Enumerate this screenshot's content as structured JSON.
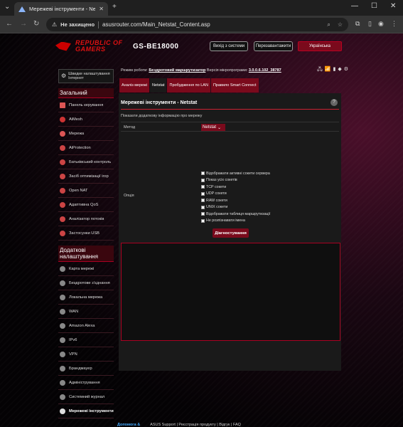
{
  "browser": {
    "tab_title": "Мережеві інструменти - Netst",
    "url_scheme": "Не захищено",
    "url": "asusrouter.com/Main_Netstat_Content.asp"
  },
  "header": {
    "brand_line1": "REPUBLIC OF",
    "brand_line2": "GAMERS",
    "model": "GS-BE18000",
    "logout": "Вихід з системи",
    "reboot": "Перезавантажити",
    "language": "Українська"
  },
  "sidebar": {
    "quick_setup": "Швидке налаштування Інтернет",
    "general_title": "Загальний",
    "general_items": [
      "Панель керування",
      "AiMesh",
      "Мережа",
      "AiProtection",
      "Батьківський контроль",
      "Засіб оптимізації ігор",
      "Open NAT",
      "Адаптивна QoS",
      "Аналізатор потоків",
      "Застосунки USB"
    ],
    "advanced_title": "Додаткові налаштування",
    "advanced_items": [
      "Карта мережі",
      "Бездротове з'єднання",
      "Локальна мережа",
      "WAN",
      "Amazon Alexa",
      "IPv6",
      "VPN",
      "Брандмауер",
      "Адміністрування",
      "Системний журнал",
      "Мережеві інструменти"
    ]
  },
  "status": {
    "mode_label": "Режим роботи:",
    "mode_value": "Бездротовий маршрутизатор",
    "fw_label": "Версія мікропрограми:",
    "fw_value": "3.0.0.6.102_38787"
  },
  "tabs": [
    "Аналіз мережі",
    "Netstat",
    "Пробудження по LAN",
    "Правило Smart Connect"
  ],
  "panel": {
    "title": "Мережеві інструменти - Netstat",
    "description": "Показати додаткову інформацію про мережу",
    "method_label": "Метод",
    "method_value": "Netstat",
    "options_label": "Опція",
    "options": [
      "Відображати активні сокети сервера",
      "Показ усіх сокетів",
      "TCP сокети",
      "UDP сокети",
      "RAW сокети",
      "UNIX сокети",
      "Відображати таблиця маршрутизації",
      "Не розпізнавати імена"
    ],
    "diagnose_button": "Діагностування"
  },
  "footer": {
    "help_link": "Допомога &",
    "links": "ASUS Support | Реєстрація продукту | Відгук | FAQ"
  }
}
